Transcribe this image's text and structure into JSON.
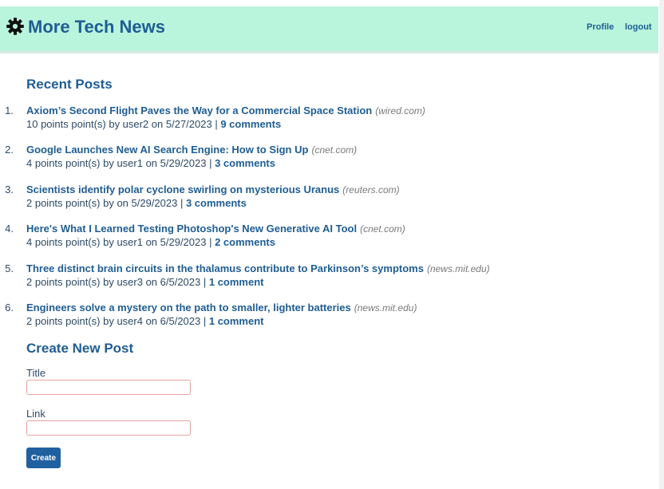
{
  "header": {
    "title": "More Tech News",
    "logo_icon": "gear-icon",
    "nav": {
      "profile": "Profile",
      "logout": "logout"
    },
    "background_color": "#b9f4dc",
    "accent_color": "#1f5d94"
  },
  "recent": {
    "heading": "Recent Posts",
    "posts": [
      {
        "number": "1.",
        "title": "Axiom’s Second Flight Paves the Way for a Commercial Space Station",
        "domain": "(wired.com)",
        "meta": "10 points point(s) by user2 on 5/27/2023 | ",
        "comments": "9 comments"
      },
      {
        "number": "2.",
        "title": "Google Launches New AI Search Engine: How to Sign Up",
        "domain": "(cnet.com)",
        "meta": "4 points point(s) by user1 on 5/29/2023 | ",
        "comments": "3 comments"
      },
      {
        "number": "3.",
        "title": "Scientists identify polar cyclone swirling on mysterious Uranus",
        "domain": "(reuters.com)",
        "meta": "2 points point(s) by on 5/29/2023 | ",
        "comments": "3 comments"
      },
      {
        "number": "4.",
        "title": "Here's What I Learned Testing Photoshop's New Generative AI Tool",
        "domain": "(cnet.com)",
        "meta": "4 points point(s) by user1 on 5/29/2023 | ",
        "comments": "2 comments"
      },
      {
        "number": "5.",
        "title": "Three distinct brain circuits in the thalamus contribute to Parkinson’s symptoms",
        "domain": "(news.mit.edu)",
        "meta": "2 points point(s) by user3 on 6/5/2023 | ",
        "comments": "1 comment"
      },
      {
        "number": "6.",
        "title": "Engineers solve a mystery on the path to smaller, lighter batteries",
        "domain": "(news.mit.edu)",
        "meta": "2 points point(s) by user4 on 6/5/2023 | ",
        "comments": "1 comment"
      }
    ]
  },
  "create": {
    "heading": "Create New Post",
    "title_label": "Title",
    "title_value": "",
    "link_label": "Link",
    "link_value": "",
    "button_label": "Create",
    "button_color": "#2160a0"
  }
}
